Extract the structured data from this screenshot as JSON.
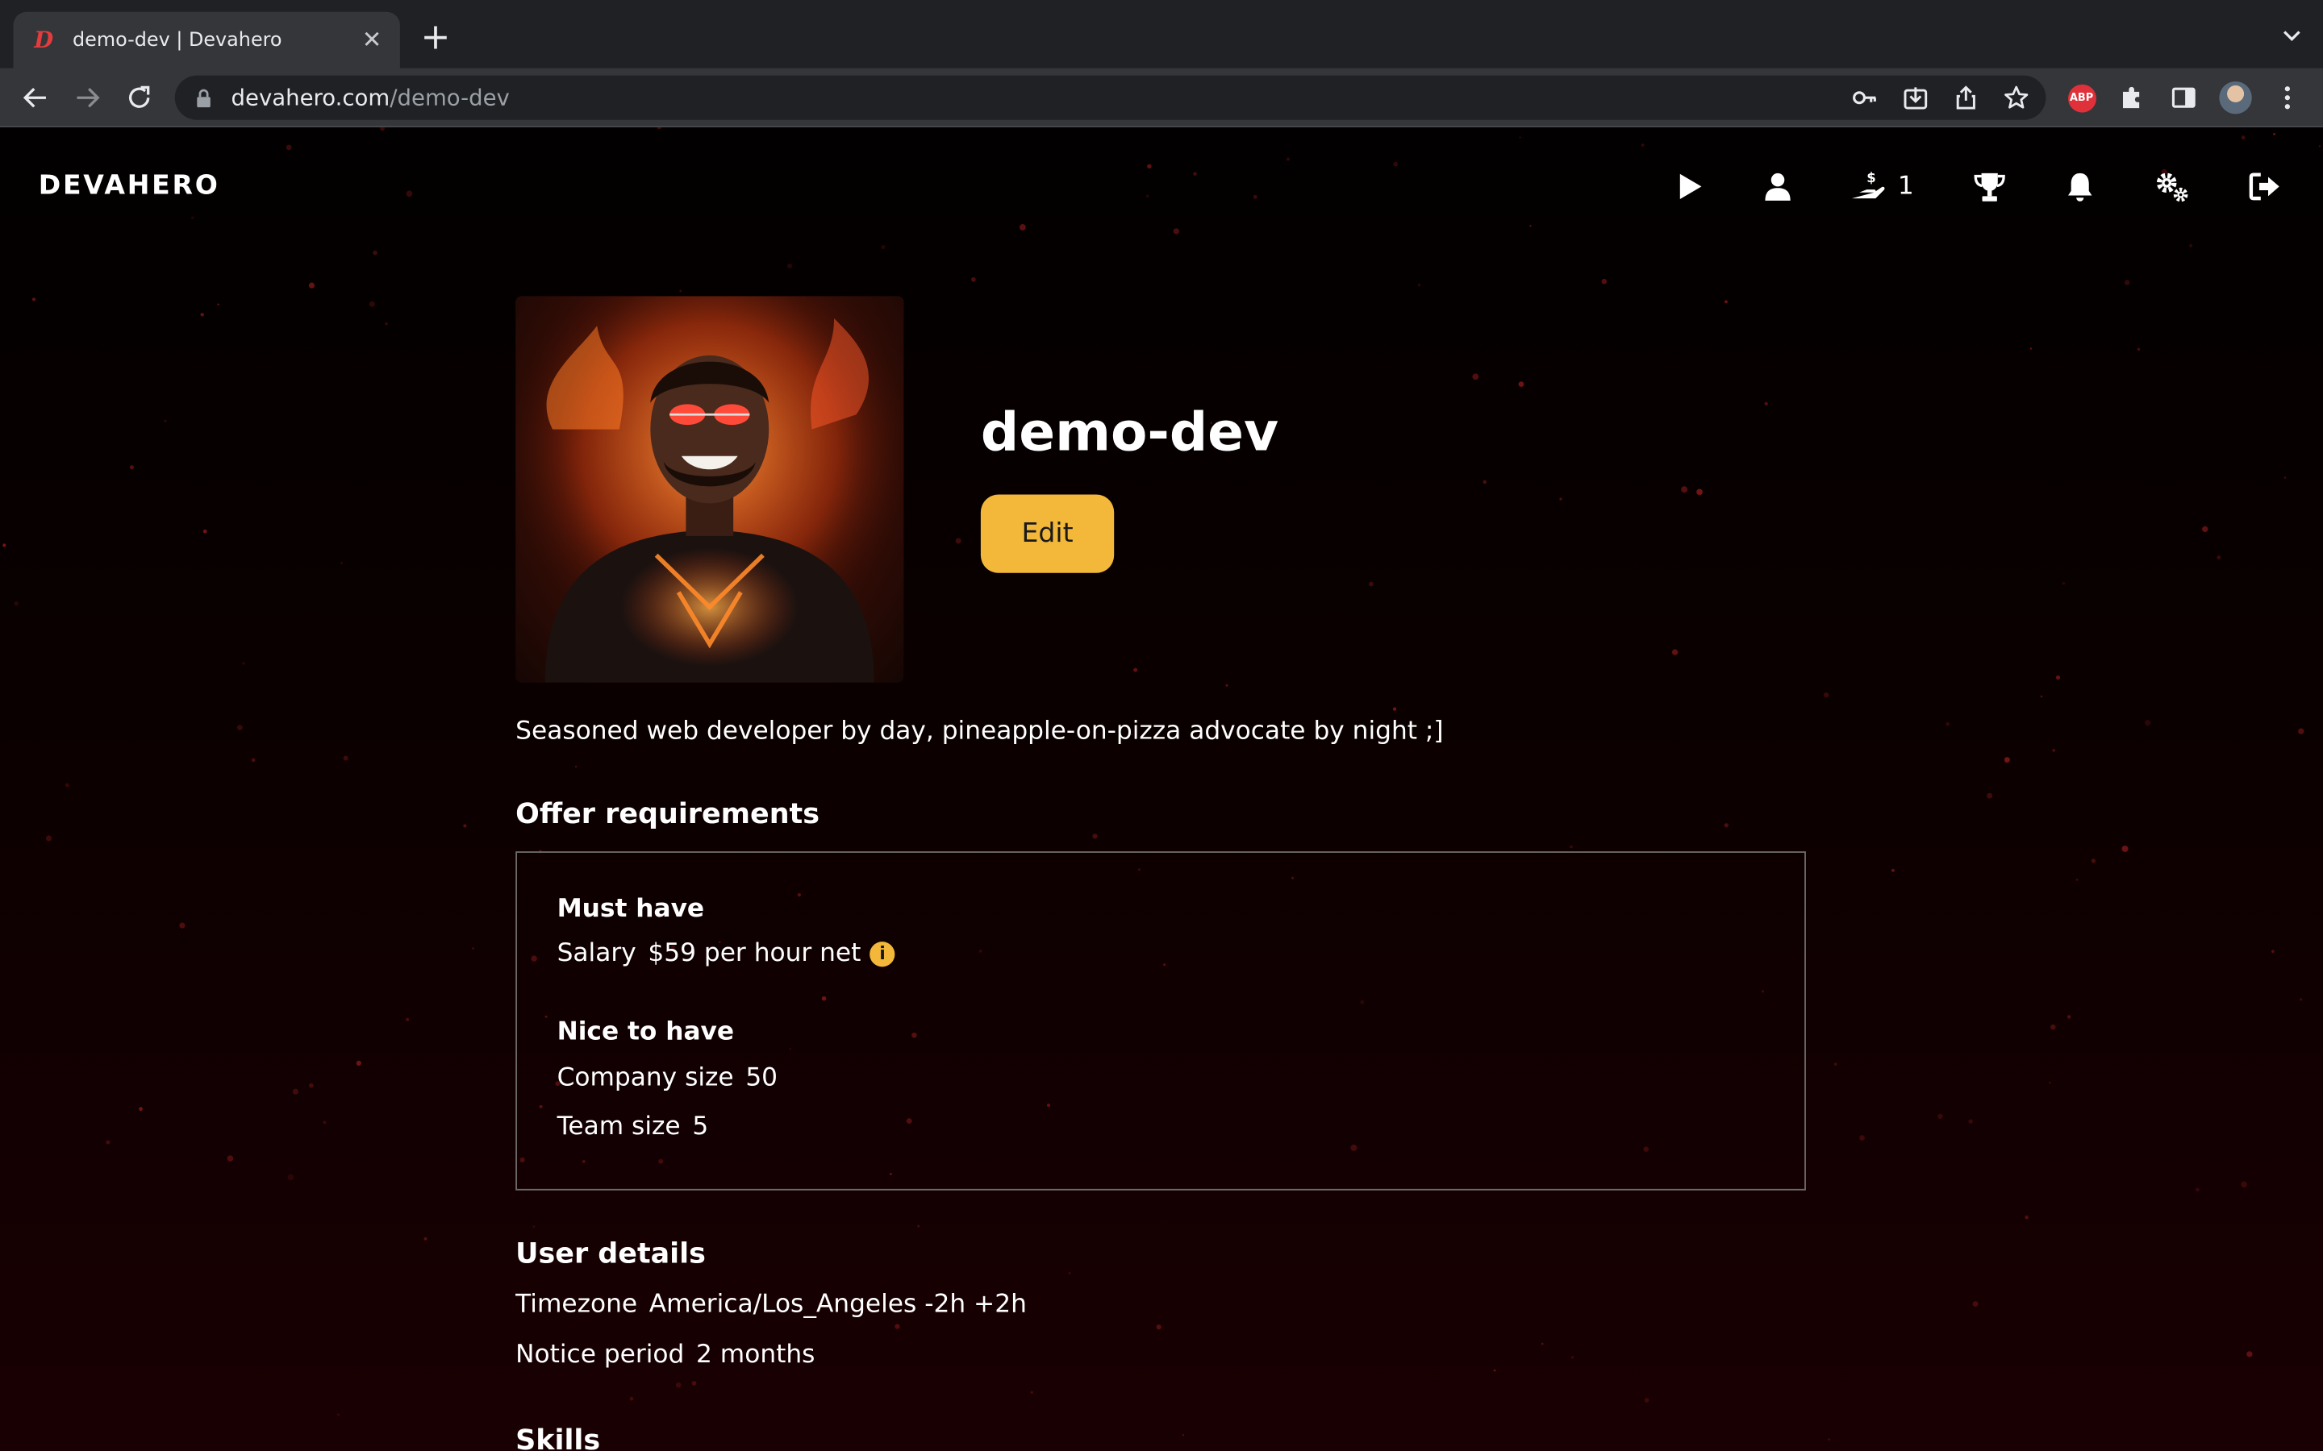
{
  "browser": {
    "tab_title": "demo-dev | Devahero",
    "tab_favicon": "D",
    "url_host": "devahero.com",
    "url_path": "/demo-dev",
    "abp_label": "ABP"
  },
  "nav": {
    "brand": "DEVAHERO",
    "offers_count": "1",
    "icons": [
      "play-icon",
      "user-icon",
      "hand-dollar-icon",
      "trophy-icon",
      "bell-icon",
      "gears-icon",
      "logout-icon"
    ]
  },
  "profile": {
    "username": "demo-dev",
    "edit_label": "Edit",
    "bio": "Seasoned web developer by day, pineapple-on-pizza advocate by night ;]"
  },
  "offer": {
    "title": "Offer requirements",
    "must_have": {
      "title": "Must have",
      "items": [
        {
          "label": "Salary",
          "value": "$59 per hour net",
          "info_icon": "i"
        }
      ]
    },
    "nice_to_have": {
      "title": "Nice to have",
      "items": [
        {
          "label": "Company size",
          "value": "50"
        },
        {
          "label": "Team size",
          "value": "5"
        }
      ]
    }
  },
  "user_details": {
    "title": "User details",
    "items": [
      {
        "label": "Timezone",
        "value": "America/Los_Angeles -2h +2h"
      },
      {
        "label": "Notice period",
        "value": "2 months"
      }
    ]
  },
  "skills": {
    "title": "Skills"
  },
  "colors": {
    "accent": "#f3b83a",
    "chrome": "#35363a",
    "background": "#000000"
  }
}
